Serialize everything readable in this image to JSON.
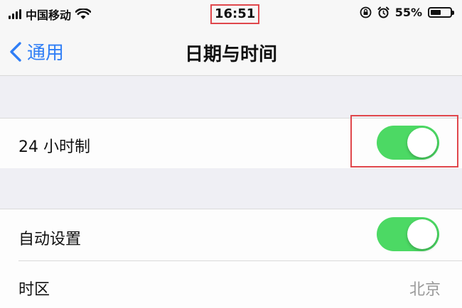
{
  "status_bar": {
    "carrier": "中国移动",
    "time": "16:51",
    "battery_percent": "55%",
    "battery_level": 0.55
  },
  "nav": {
    "back_label": "通用",
    "title": "日期与时间"
  },
  "settings": {
    "hour24": {
      "label": "24 小时制",
      "enabled": true
    },
    "auto_set": {
      "label": "自动设置",
      "enabled": true
    },
    "timezone": {
      "label": "时区",
      "value": "北京"
    }
  },
  "colors": {
    "accent": "#2f7ef6",
    "toggle_on": "#4cd964",
    "highlight": "#e0474c"
  }
}
